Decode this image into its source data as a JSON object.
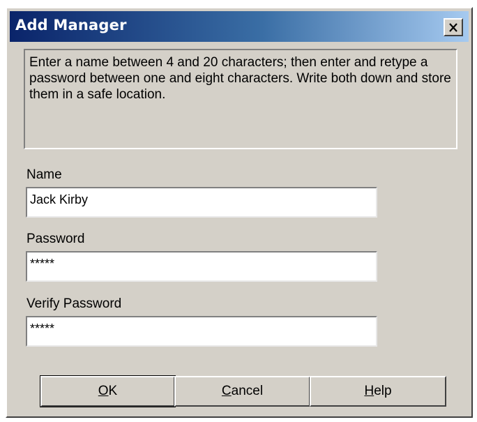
{
  "window": {
    "title": "Add Manager",
    "close_symbol": "X"
  },
  "instructions": {
    "text": "Enter a name between 4 and 20 characters; then enter and retype a password between one and eight characters.  Write both down and store them in a safe location."
  },
  "form": {
    "name": {
      "label": "Name",
      "value": "Jack Kirby"
    },
    "password": {
      "label": "Password",
      "value": "*****"
    },
    "verify_password": {
      "label": "Verify Password",
      "value": "*****"
    }
  },
  "buttons": {
    "ok": {
      "mnemonic": "O",
      "rest": "K"
    },
    "cancel": {
      "mnemonic": "C",
      "rest": "ancel"
    },
    "help": {
      "mnemonic": "H",
      "rest": "elp"
    }
  },
  "icons": {
    "close": "close-icon"
  },
  "colors": {
    "title_gradient_start": "#0a246a",
    "title_gradient_end": "#a6caf0",
    "dialog_face": "#d4d0c8"
  }
}
